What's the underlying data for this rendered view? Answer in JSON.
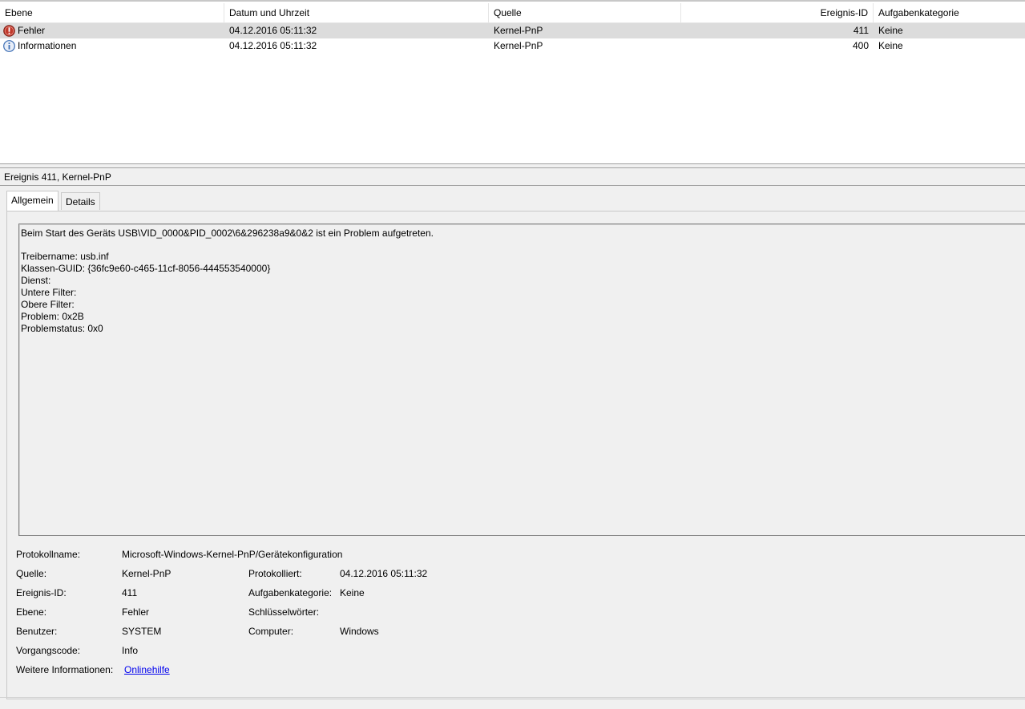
{
  "event_list": {
    "columns": [
      "Ebene",
      "Datum und Uhrzeit",
      "Quelle",
      "Ereignis-ID",
      "Aufgabenkategorie"
    ],
    "rows": [
      {
        "level": "Fehler",
        "level_icon": "error-icon",
        "datetime": "04.12.2016 05:11:32",
        "source": "Kernel-PnP",
        "event_id": "411",
        "category": "Keine",
        "selected": true
      },
      {
        "level": "Informationen",
        "level_icon": "info-icon",
        "datetime": "04.12.2016 05:11:32",
        "source": "Kernel-PnP",
        "event_id": "400",
        "category": "Keine",
        "selected": false
      }
    ]
  },
  "detail": {
    "title": "Ereignis 411, Kernel-PnP",
    "tabs": [
      "Allgemein",
      "Details"
    ],
    "active_tab": "Allgemein",
    "message": {
      "line1": "Beim Start des Geräts USB\\VID_0000&PID_0002\\6&296238a9&0&2 ist ein Problem aufgetreten.",
      "lines": [
        "Treibername: usb.inf",
        "Klassen-GUID: {36fc9e60-c465-11cf-8056-444553540000}",
        "Dienst:",
        "Untere Filter:",
        "Obere Filter:",
        "Problem: 0x2B",
        "Problemstatus: 0x0"
      ]
    },
    "properties": {
      "log_name_label": "Protokollname:",
      "log_name": "Microsoft-Windows-Kernel-PnP/Gerätekonfiguration",
      "source_label": "Quelle:",
      "source": "Kernel-PnP",
      "logged_label": "Protokolliert:",
      "logged": "04.12.2016 05:11:32",
      "event_id_label": "Ereignis-ID:",
      "event_id": "411",
      "category_label": "Aufgabenkategorie:",
      "category": "Keine",
      "level_label": "Ebene:",
      "level": "Fehler",
      "keywords_label": "Schlüsselwörter:",
      "keywords": "",
      "user_label": "Benutzer:",
      "user": "SYSTEM",
      "computer_label": "Computer:",
      "computer": "Windows",
      "opcode_label": "Vorgangscode:",
      "opcode": "Info",
      "more_info_label": "Weitere Informationen:",
      "more_info_link": "Onlinehilfe"
    }
  },
  "colors": {
    "selected_row": "#dcdcdc",
    "pane_background": "#f0f0f0",
    "error_icon": "#c0392b",
    "info_icon": "#3c6eb4",
    "link": "#0000ee"
  }
}
